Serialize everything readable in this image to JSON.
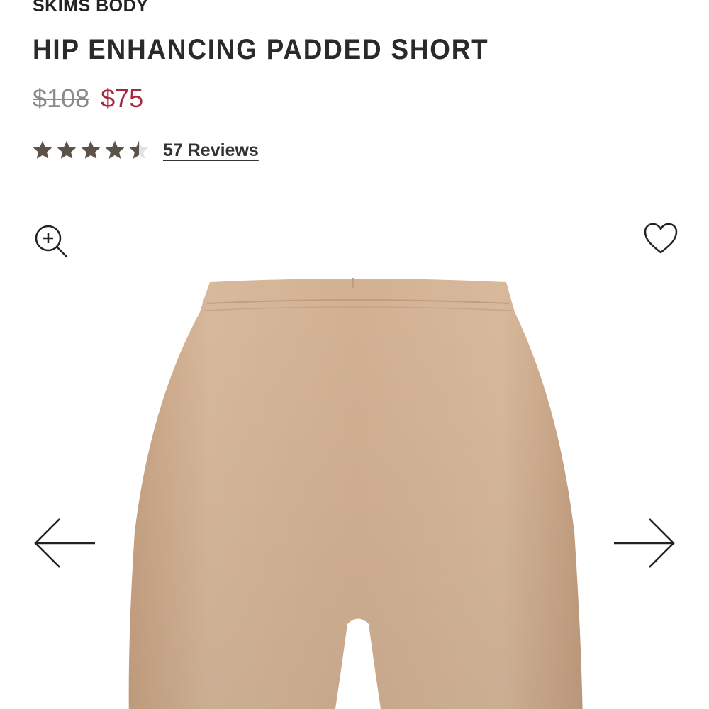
{
  "product": {
    "brand": "SKIMS BODY",
    "title": "HIP ENHANCING PADDED SHORT",
    "price_original": "$108",
    "price_sale": "$75",
    "rating_value": 4.5,
    "rating_max": 5,
    "reviews_label": "57 Reviews"
  },
  "icons": {
    "zoom": "zoom-in-icon",
    "favorite": "heart-icon",
    "previous": "arrow-left-icon",
    "next": "arrow-right-icon"
  },
  "colors": {
    "sale_price": "#a8283e",
    "original_price": "#8a8a8a",
    "star_filled": "#5b5249",
    "star_empty": "#e2e2e2",
    "product_fabric": "#d4b295"
  }
}
